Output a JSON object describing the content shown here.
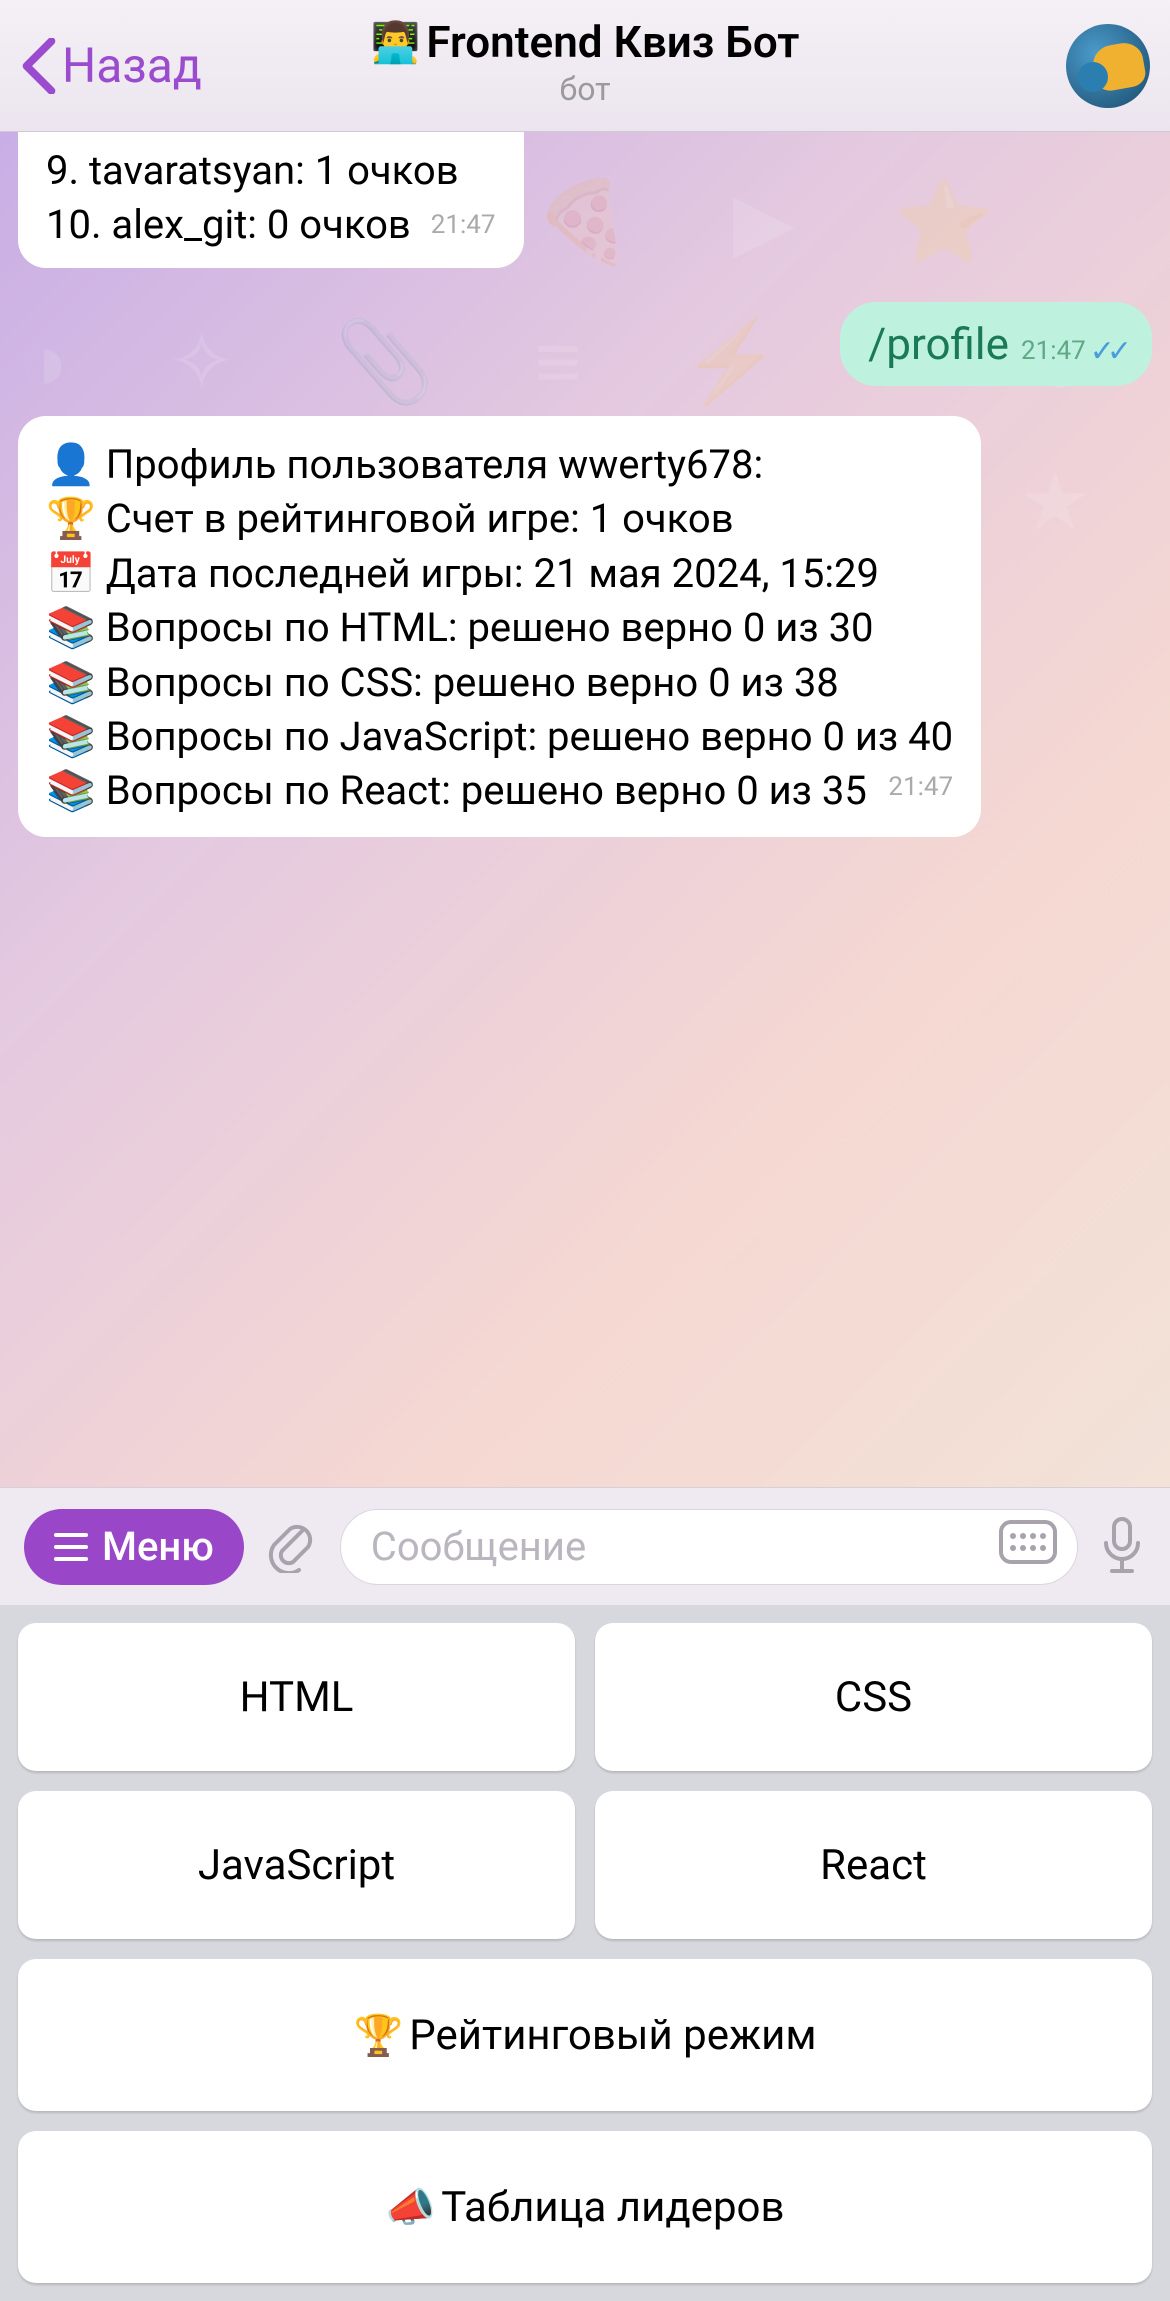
{
  "header": {
    "back_label": "Назад",
    "title_emoji": "👨‍💻",
    "title": "Frontend Квиз Бот",
    "subtitle": "бот"
  },
  "chat": {
    "top_bubble": {
      "line1": "9. tavaratsyan: 1 очков",
      "line2": "10. alex_git: 0 очков",
      "time": "21:47"
    },
    "out_bubble": {
      "command": "/profile",
      "time": "21:47"
    },
    "profile_bubble": {
      "l1": "👤 Профиль пользователя wwerty678:",
      "l2": "🏆 Счет в рейтинговой игре: 1 очков",
      "l3": "📅 Дата последней игры: 21 мая 2024, 15:29",
      "l4": "📚 Вопросы по HTML: решено верно 0 из 30",
      "l5": "📚 Вопросы по CSS: решено верно 0 из 38",
      "l6": "📚 Вопросы по JavaScript: решено верно 0 из 40",
      "l7": "📚 Вопросы по React: решено верно 0 из 35",
      "time": "21:47"
    }
  },
  "inputbar": {
    "menu_label": "Меню",
    "placeholder": "Сообщение"
  },
  "keyboard": {
    "btn_html": "HTML",
    "btn_css": "CSS",
    "btn_js": "JavaScript",
    "btn_react": "React",
    "btn_rating": "Рейтинговый режим",
    "btn_leaders": "Таблица лидеров",
    "trophy": "🏆",
    "horn": "📣"
  }
}
